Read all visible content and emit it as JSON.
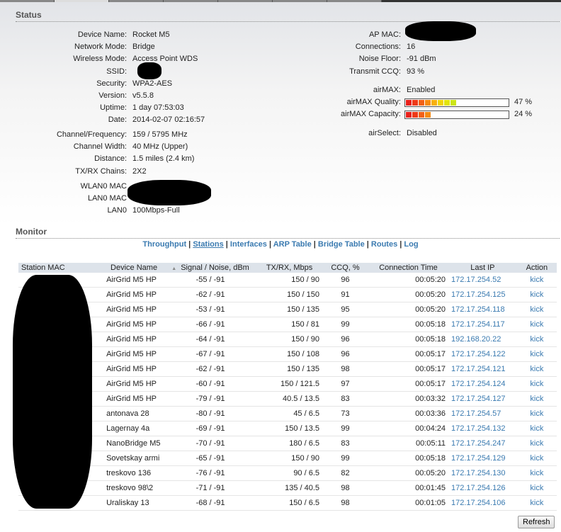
{
  "status": {
    "title": "Status",
    "left": [
      [
        "Device Name:",
        "Rocket M5"
      ],
      [
        "Network Mode:",
        "Bridge"
      ],
      [
        "Wireless Mode:",
        "Access Point WDS"
      ],
      [
        "SSID:",
        ""
      ],
      [
        "Security:",
        "WPA2-AES"
      ],
      [
        "Version:",
        "v5.5.8"
      ],
      [
        "Uptime:",
        "1 day 07:53:03"
      ],
      [
        "Date:",
        "2014-02-07 02:16:57"
      ]
    ],
    "left2": [
      [
        "Channel/Frequency:",
        "159 / 5795 MHz"
      ],
      [
        "Channel Width:",
        "40 MHz (Upper)"
      ],
      [
        "Distance:",
        "1.5 miles (2.4 km)"
      ],
      [
        "TX/RX Chains:",
        "2X2"
      ]
    ],
    "left3": [
      [
        "WLAN0 MAC",
        ""
      ],
      [
        "LAN0 MAC",
        ""
      ],
      [
        "LAN0",
        "100Mbps-Full"
      ]
    ],
    "right": [
      [
        "AP MAC:",
        ""
      ],
      [
        "Connections:",
        "16"
      ],
      [
        "Noise Floor:",
        "-91 dBm"
      ],
      [
        "Transmit CCQ:",
        "93 %"
      ]
    ],
    "airmax": {
      "label": "airMAX:",
      "value": "Enabled"
    },
    "quality": {
      "label": "airMAX Quality:",
      "value": "47 %",
      "percent": 47
    },
    "capacity": {
      "label": "airMAX Capacity:",
      "value": "24 %",
      "percent": 24
    },
    "airselect": {
      "label": "airSelect:",
      "value": "Disabled"
    }
  },
  "monitor": {
    "title": "Monitor",
    "links": [
      "Throughput",
      "Stations",
      "Interfaces",
      "ARP Table",
      "Bridge Table",
      "Routes",
      "Log"
    ],
    "headers": [
      "Station MAC",
      "Device Name",
      "Signal / Noise, dBm",
      "TX/RX, Mbps",
      "CCQ, %",
      "Connection Time",
      "Last IP",
      "Action"
    ],
    "rows": [
      [
        "AirGrid M5 HP",
        "-55 / -91",
        "150 / 90",
        "96",
        "00:05:20",
        "172.17.254.52",
        "kick"
      ],
      [
        "AirGrid M5 HP",
        "-62 / -91",
        "150 / 150",
        "91",
        "00:05:20",
        "172.17.254.125",
        "kick"
      ],
      [
        "AirGrid M5 HP",
        "-53 / -91",
        "150 / 135",
        "95",
        "00:05:20",
        "172.17.254.118",
        "kick"
      ],
      [
        "AirGrid M5 HP",
        "-66 / -91",
        "150 / 81",
        "99",
        "00:05:18",
        "172.17.254.117",
        "kick"
      ],
      [
        "AirGrid M5 HP",
        "-64 / -91",
        "150 / 90",
        "96",
        "00:05:18",
        "192.168.20.22",
        "kick"
      ],
      [
        "AirGrid M5 HP",
        "-67 / -91",
        "150 / 108",
        "96",
        "00:05:17",
        "172.17.254.122",
        "kick"
      ],
      [
        "AirGrid M5 HP",
        "-62 / -91",
        "150 / 135",
        "98",
        "00:05:17",
        "172.17.254.121",
        "kick"
      ],
      [
        "AirGrid M5 HP",
        "-60 / -91",
        "150 / 121.5",
        "97",
        "00:05:17",
        "172.17.254.124",
        "kick"
      ],
      [
        "AirGrid M5 HP",
        "-79 / -91",
        "40.5 / 13.5",
        "83",
        "00:03:32",
        "172.17.254.127",
        "kick"
      ],
      [
        "antonava 28",
        "-80 / -91",
        "45 / 6.5",
        "73",
        "00:03:36",
        "172.17.254.57",
        "kick"
      ],
      [
        "Lagernay 4a",
        "-69 / -91",
        "150 / 13.5",
        "99",
        "00:04:24",
        "172.17.254.132",
        "kick"
      ],
      [
        "NanoBridge M5",
        "-70 / -91",
        "180 / 6.5",
        "83",
        "00:05:11",
        "172.17.254.247",
        "kick"
      ],
      [
        "Sovetskay armi",
        "-65 / -91",
        "150 / 90",
        "99",
        "00:05:18",
        "172.17.254.129",
        "kick"
      ],
      [
        "treskovo 136",
        "-76 / -91",
        "90 / 6.5",
        "82",
        "00:05:20",
        "172.17.254.130",
        "kick"
      ],
      [
        "treskovo 98\\2",
        "-71 / -91",
        "135 / 40.5",
        "98",
        "00:01:45",
        "172.17.254.126",
        "kick"
      ],
      [
        "Uraliskay 13",
        "-68 / -91",
        "150 / 6.5",
        "98",
        "00:01:05",
        "172.17.254.106",
        "kick"
      ]
    ],
    "refresh": "Refresh"
  }
}
